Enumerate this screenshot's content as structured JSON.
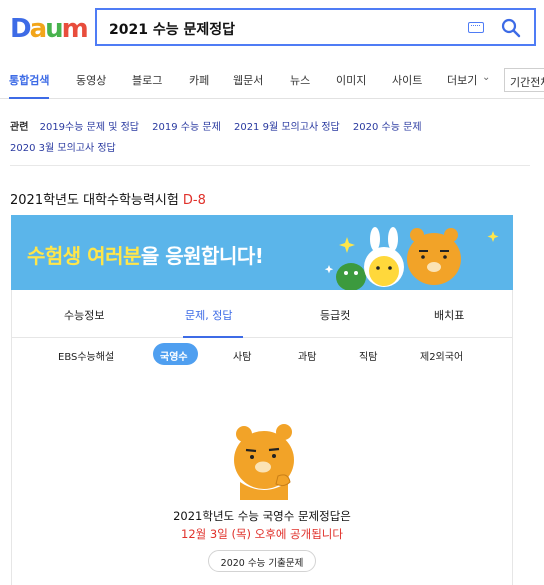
{
  "header": {
    "logo_letters": [
      "D",
      "a",
      "u",
      "m"
    ],
    "search_query": "2021 수능 문제정답"
  },
  "colors": {
    "accent": "#3d6be6",
    "dday": "#e0312b",
    "banner": "#5bb5ea",
    "pill": "#4f9ff0"
  },
  "tabs": [
    {
      "label": "통합검색",
      "active": true
    },
    {
      "label": "동영상"
    },
    {
      "label": "블로그"
    },
    {
      "label": "카페"
    },
    {
      "label": "웹문서"
    },
    {
      "label": "뉴스"
    },
    {
      "label": "이미지"
    },
    {
      "label": "사이트"
    },
    {
      "label": "더보기"
    }
  ],
  "period_label": "기간전체",
  "related": {
    "label": "관련",
    "links": [
      "2019수능 문제 및 정답",
      "2019 수능 문제",
      "2021 9월 모의고사 정답",
      "2020 수능 문제",
      "2020 3월 모의고사 정답"
    ]
  },
  "csat": {
    "title": "2021학년도 대학수학능력시험",
    "dday": "D-8",
    "banner": {
      "highlight": "수험생 여러분",
      "rest": "을 응원합니다!"
    },
    "sub_tabs": [
      {
        "label": "수능정보"
      },
      {
        "label": "문제, 정답",
        "active": true
      },
      {
        "label": "등급컷"
      },
      {
        "label": "배치표"
      }
    ],
    "subjects": [
      {
        "label": "EBS수능해설"
      },
      {
        "label": "국영수",
        "active": true
      },
      {
        "label": "사탐"
      },
      {
        "label": "과탐"
      },
      {
        "label": "직탐"
      },
      {
        "label": "제2외국어"
      }
    ],
    "notice_line1": "2021학년도 수능 국영수 문제정답은",
    "notice_line2": "12월 3일 (목) 오후에 공개됩니다",
    "past_button": "2020 수능 기출문제"
  }
}
